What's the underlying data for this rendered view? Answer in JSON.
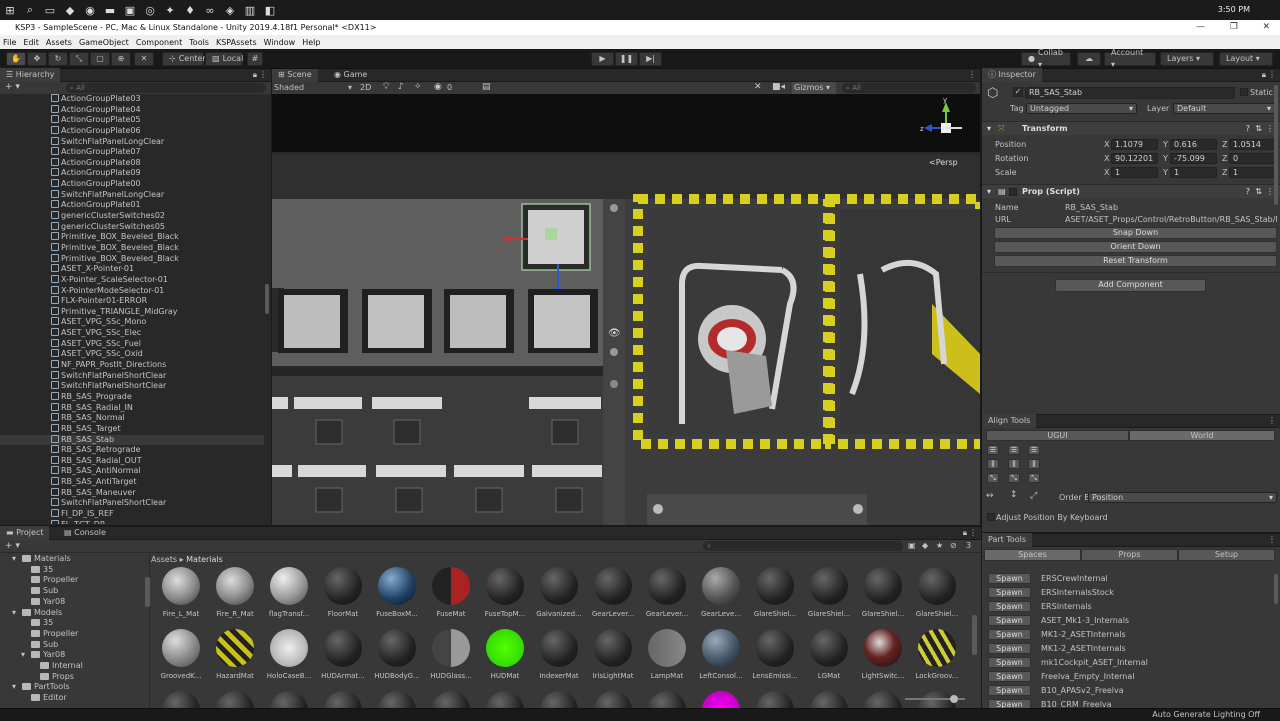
{
  "taskbar": {
    "clock": "3:50 PM"
  },
  "window": {
    "title": "KSP3 - SampleScene - PC, Mac & Linux Standalone - Unity 2019.4.18f1 Personal* <DX11>"
  },
  "menu": [
    "File",
    "Edit",
    "Assets",
    "GameObject",
    "Component",
    "Tools",
    "KSPAssets",
    "Window",
    "Help"
  ],
  "toolbar": {
    "pivot_center": "Center",
    "pivot_local": "Local",
    "collab": "Collab ▾",
    "account": "Account ▾",
    "layers": "Layers ▾",
    "layout": "Layout ▾"
  },
  "hierarchy": {
    "tab": "Hierarchy",
    "search_placeholder": "All",
    "items": [
      "ActionGroupPlate03",
      "ActionGroupPlate04",
      "ActionGroupPlate05",
      "ActionGroupPlate06",
      "SwitchFlatPanelLongClear",
      "ActionGroupPlate07",
      "ActionGroupPlate08",
      "ActionGroupPlate09",
      "ActionGroupPlate00",
      "SwitchFlatPanelLongClear",
      "ActionGroupPlate01",
      "genericClusterSwitches02",
      "genericClusterSwitches05",
      "Primitive_BOX_Beveled_Black",
      "Primitive_BOX_Beveled_Black",
      "Primitive_BOX_Beveled_Black",
      "ASET_X-Pointer-01",
      "X-Pointer_ScaleSelector-01",
      "X-PointerModeSelector-01",
      "FLX-Pointer01-ERROR",
      "Primitive_TRIANGLE_MidGray",
      "ASET_VPG_SSc_Mono",
      "ASET_VPG_SSc_Elec",
      "ASET_VPG_SSc_Fuel",
      "ASET_VPG_SSc_Oxid",
      "NF_PAPR_PostIt_Directions",
      "SwitchFlatPanelShortClear",
      "SwitchFlatPanelShortClear",
      "RB_SAS_Prograde",
      "RB_SAS_Radial_IN",
      "RB_SAS_Normal",
      "RB_SAS_Target",
      "RB_SAS_Stab",
      "RB_SAS_Retrograde",
      "RB_SAS_Radial_OUT",
      "RB_SAS_AntiNormal",
      "RB_SAS_AntiTarget",
      "RB_SAS_Maneuver",
      "SwitchFlatPanelShortClear",
      "FI_DP_IS_REF",
      "FL_TGT_DP"
    ],
    "selected_index": 32
  },
  "scene": {
    "tab_scene": "Scene",
    "tab_game": "Game",
    "shading": "Shaded",
    "mode_2d": "2D",
    "fx_count": "0",
    "gizmos": "Gizmos",
    "search_placeholder": "All",
    "persp": "<Persp"
  },
  "inspector": {
    "tab": "Inspector",
    "object_name": "RB_SAS_Stab",
    "static": "Static",
    "tag_label": "Tag",
    "tag_value": "Untagged",
    "layer_label": "Layer",
    "layer_value": "Default",
    "transform": {
      "title": "Transform",
      "position_label": "Position",
      "rotation_label": "Rotation",
      "scale_label": "Scale",
      "position": {
        "x": "1.1079",
        "y": "0.616",
        "z": "1.0514"
      },
      "rotation": {
        "x": "90.12201",
        "y": "-75.099",
        "z": "0"
      },
      "scale": {
        "x": "1",
        "y": "1",
        "z": "1"
      }
    },
    "prop": {
      "title": "Prop (Script)",
      "name_label": "Name",
      "name_value": "RB_SAS_Stab",
      "url_label": "URL",
      "url_value": "ASET/ASET_Props/Control/RetroButton/RB_SAS_Stab/RB_",
      "snap_down": "Snap Down",
      "orient_down": "Orient Down",
      "reset_transform": "Reset Transform"
    },
    "add_component": "Add Component"
  },
  "align_tools": {
    "tab": "Align Tools",
    "mode_ugui": "UGUI",
    "mode_world": "World",
    "order_by_label": "Order By",
    "order_by_value": "Position",
    "adjust_label": "Adjust Position By Keyboard"
  },
  "part_tools": {
    "tab": "Part Tools",
    "tabs": [
      "Spaces",
      "Props",
      "Setup"
    ],
    "spawn_label": "Spawn",
    "items": [
      "ERSCrewInternal",
      "ERSInternalsStock",
      "ERSInternals",
      "ASET_Mk1-3_Internals",
      "MK1-2_ASETInternals",
      "MK1-2_ASETInternals",
      "mk1Cockpit_ASET_Internal",
      "Freelva_Empty_Internal",
      "B10_APASv2_Freelva",
      "B10_CRM_Freelva"
    ]
  },
  "project": {
    "tab_project": "Project",
    "tab_console": "Console",
    "breadcrumb_root": "Assets",
    "breadcrumb_sep": "▸",
    "breadcrumb_current": "Materials",
    "count": "3",
    "tree": [
      {
        "label": "Materials",
        "depth": 0,
        "open": true
      },
      {
        "label": "35",
        "depth": 1
      },
      {
        "label": "Propeller",
        "depth": 1
      },
      {
        "label": "Sub",
        "depth": 1
      },
      {
        "label": "Yar08",
        "depth": 1
      },
      {
        "label": "Models",
        "depth": 0,
        "open": true
      },
      {
        "label": "35",
        "depth": 1
      },
      {
        "label": "Propeller",
        "depth": 1
      },
      {
        "label": "Sub",
        "depth": 1
      },
      {
        "label": "Yar08",
        "depth": 1,
        "open": true
      },
      {
        "label": "Internal",
        "depth": 2
      },
      {
        "label": "Props",
        "depth": 2
      },
      {
        "label": "PartTools",
        "depth": 0,
        "open": true
      },
      {
        "label": "Editor",
        "depth": 1
      }
    ],
    "assets_row1": [
      "Fire_L_Mat",
      "Fire_R_Mat",
      "flagTransf...",
      "FloorMat",
      "FuseBoxM...",
      "FuseMat",
      "FuseTopM...",
      "Galvanized...",
      "GearLever...",
      "GearLever...",
      "GearLeve...",
      "GlareShiel...",
      "GlareShiel...",
      "GlareShiel...",
      "GlareShiel..."
    ],
    "assets_row2": [
      "GroovedK...",
      "HazardMat",
      "HoloCaseB...",
      "HUDArmat...",
      "HUDBodyG...",
      "HUDGlass...",
      "HUDMat",
      "IndexerMat",
      "IrisLightMat",
      "LampMat",
      "LeftConsol...",
      "LensEmissi...",
      "LGMat",
      "LightSwitc...",
      "LockGroov..."
    ]
  },
  "status": {
    "lighting": "Auto Generate Lighting Off"
  }
}
